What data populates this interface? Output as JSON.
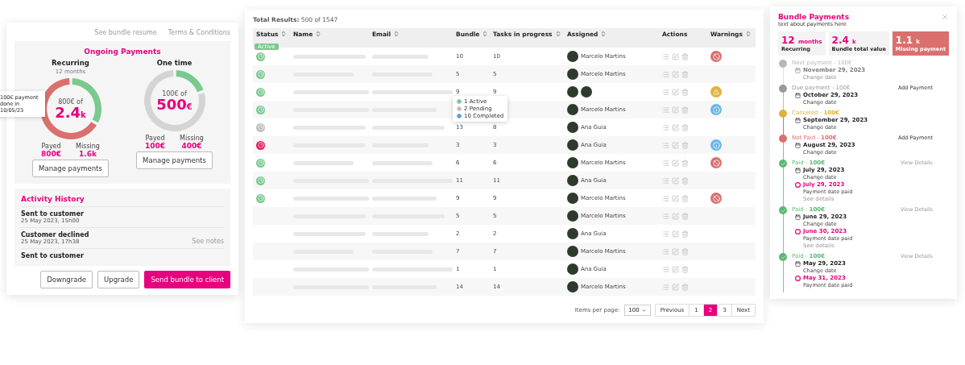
{
  "bundle": {
    "links": [
      "See bundle resume",
      "Terms & Conditions"
    ],
    "payments_title": "Ongoing Payments",
    "payments": [
      {
        "label": "Recurring",
        "sublabel": "12 months",
        "of": "800€ of",
        "amount": "2.4",
        "unit": "k",
        "chart_data": {
          "type": "donut",
          "categories": [
            "Payed",
            "Missing"
          ],
          "values": [
            33.3,
            66.7
          ],
          "colors": [
            "#7ac98f",
            "#d9706e"
          ]
        },
        "tooltip": "100€ payment done in 10/05/23",
        "stats": [
          {
            "value": "800€"
          },
          {
            "value": "1.6k"
          }
        ],
        "button": "Manage payments"
      },
      {
        "label": "One time",
        "of": "100€ of",
        "amount": "500",
        "unit": "€",
        "chart_data": {
          "type": "donut",
          "categories": [
            "Payed",
            "Missing"
          ],
          "values": [
            20,
            80
          ],
          "colors": [
            "#7ac98f",
            "#d4d4d4"
          ]
        },
        "stats": [
          {
            "value": "100€"
          },
          {
            "value": "400€"
          }
        ],
        "button": "Manage payments"
      }
    ],
    "activity_title": "Activity History",
    "activity": [
      {
        "title": "Sent to customer",
        "time": "25 May 2023, 15h00"
      },
      {
        "title": "Customer declined",
        "time": "25 May 2023, 17h38",
        "note": "See notes"
      },
      {
        "title": "Sent to customer"
      }
    ],
    "buttons": [
      {
        "label": "Downgrade",
        "kind": "outline"
      },
      {
        "label": "Upgrade",
        "kind": "outline"
      },
      {
        "label": "Send bundle to client",
        "kind": "primary"
      }
    ]
  },
  "table": {
    "total": "**Total Results:** 500 of 1547",
    "columns": [
      {
        "label": "Status",
        "sortable": true
      },
      {
        "label": "Name",
        "sortable": true
      },
      {
        "label": "Email",
        "sortable": true
      },
      {
        "label": "Bundle",
        "sortable": true
      },
      {
        "label": "Tasks in progress",
        "sortable": true
      },
      {
        "label": "Assigned",
        "sortable": true
      },
      {
        "label": "Actions",
        "sortable": false
      },
      {
        "label": "Warnings",
        "sortable": true
      }
    ],
    "status_tooltip": "Active",
    "bundle_tooltip": [
      {
        "label": "1 Active",
        "color": "#7ac98f"
      },
      {
        "label": "2 Pending",
        "color": "#bdbdbd"
      },
      {
        "label": "10 Completed",
        "color": "#5b9be6"
      }
    ],
    "rows": [
      {
        "color": "#7ac98f",
        "bundle": "10",
        "tasks": "10",
        "avatars": [
          {
            "kind": "photo"
          }
        ],
        "assigned": "Marcelo Martins",
        "warning": {
          "kind": "blocked"
        }
      },
      {
        "color": "#7ac98f",
        "bundle": "5",
        "tasks": "5",
        "avatars": [
          {
            "kind": "photo"
          }
        ],
        "assigned": "Marcelo Martins"
      },
      {
        "color": "#7ac98f",
        "bundle": "9",
        "tasks": "9",
        "avatars": [
          {
            "kind": "photo"
          },
          {
            "kind": "photo"
          }
        ],
        "warning": {
          "kind": "alert"
        }
      },
      {
        "color": "#7ac98f",
        "avatars": [
          {
            "kind": "photo"
          }
        ],
        "assigned": "Marcelo Martins",
        "warning": {
          "kind": "info"
        }
      },
      {
        "color": "#bdbdbd",
        "bundle": "13",
        "tasks": "8",
        "avatars": [
          {
            "kind": "photo"
          }
        ],
        "assigned": "Ana Guia"
      },
      {
        "color": "#e8175d",
        "bundle": "3",
        "tasks": "3",
        "avatars": [
          {
            "kind": "photo"
          }
        ],
        "assigned": "Ana Guia",
        "warning": {
          "kind": "info"
        }
      },
      {
        "color": "#7ac98f",
        "bundle": "6",
        "tasks": "6",
        "avatars": [
          {
            "kind": "photo"
          }
        ],
        "assigned": "Marcelo Martins",
        "warning": {
          "kind": "blocked"
        }
      },
      {
        "color": "#7ac98f",
        "bundle": "11",
        "tasks": "11",
        "avatars": [
          {
            "kind": "photo"
          }
        ],
        "assigned": "Ana Guia"
      },
      {
        "color": "#7ac98f",
        "bundle": "9",
        "tasks": "9",
        "avatars": [
          {
            "kind": "photo"
          }
        ],
        "assigned": "Marcelo Martins",
        "warning": {
          "kind": "blocked"
        }
      },
      {
        "bundle": "5",
        "tasks": "5",
        "avatars": [
          {
            "kind": "photo"
          }
        ],
        "assigned": "Marcelo Martins"
      },
      {
        "bundle": "2",
        "tasks": "2",
        "avatars": [
          {
            "kind": "photo"
          }
        ],
        "assigned": "Ana Guia"
      },
      {
        "bundle": "7",
        "tasks": "7",
        "avatars": [
          {
            "kind": "photo"
          }
        ],
        "assigned": "Marcelo Martins"
      },
      {
        "bundle": "1",
        "tasks": "1",
        "avatars": [
          {
            "kind": "photo"
          }
        ],
        "assigned": "Ana Guia"
      },
      {
        "bundle": "14",
        "tasks": "14",
        "avatars": [
          {
            "kind": "photo"
          }
        ],
        "assigned": "Marcelo Martins"
      }
    ],
    "pagination": {
      "label": "Items per page:",
      "per_page": "100",
      "pages": [
        {
          "label": "Previous",
          "selected": false
        },
        {
          "label": "1",
          "selected": false
        },
        {
          "label": "2",
          "selected": true
        },
        {
          "label": "3",
          "selected": false
        },
        {
          "label": "Next",
          "selected": false
        }
      ]
    }
  },
  "bundle_payments": {
    "title": "Bundle Payments",
    "subtitle": "text about payments here",
    "stats": [
      {
        "value": "12",
        "unit": "months",
        "label": "Recurring",
        "kind": "plain"
      },
      {
        "value": "2.4",
        "unit": "k",
        "label": "Bundle total value",
        "kind": "plain"
      },
      {
        "value": "1.1",
        "unit": "k",
        "label": "Missing payment",
        "kind": "alert"
      }
    ],
    "timeline": [
      {
        "kind": "next",
        "label": "Next payment - 100€",
        "date": "November 29, 2023",
        "date_note": "Change date"
      },
      {
        "kind": "due",
        "label": "Due payment - 100€",
        "date": "October 29, 2023",
        "date_note": "Change date",
        "action": "Add Payment"
      },
      {
        "kind": "canceled",
        "label": "Canceled - **100€**",
        "date": "September 29, 2023",
        "date_note": "Change date"
      },
      {
        "kind": "notpaid",
        "label": "Not Paid - **100€**",
        "date": "August 29, 2023",
        "date_note": "Change date",
        "action": "Add Payment"
      },
      {
        "kind": "paid",
        "label": "Paid - **100€**",
        "date": "July 29, 2023",
        "date_note": "Change date",
        "action": "View Details",
        "paid_date": "July 29, 2023",
        "paid_note": "Payment date paid",
        "details": "See details"
      },
      {
        "kind": "paid",
        "label": "Paid - **100€**",
        "date": "June 29, 2023",
        "date_note": "Change date",
        "action": "View Details",
        "paid_date": "June 30, 2023",
        "paid_note": "Payment date paid",
        "details": "See details"
      },
      {
        "kind": "paid",
        "label": "Paid - **100€**",
        "date": "May 29, 2023",
        "date_note": "Change date",
        "action": "View Details",
        "paid_date": "May 31, 2023",
        "paid_note": "Payment date paid"
      }
    ]
  }
}
